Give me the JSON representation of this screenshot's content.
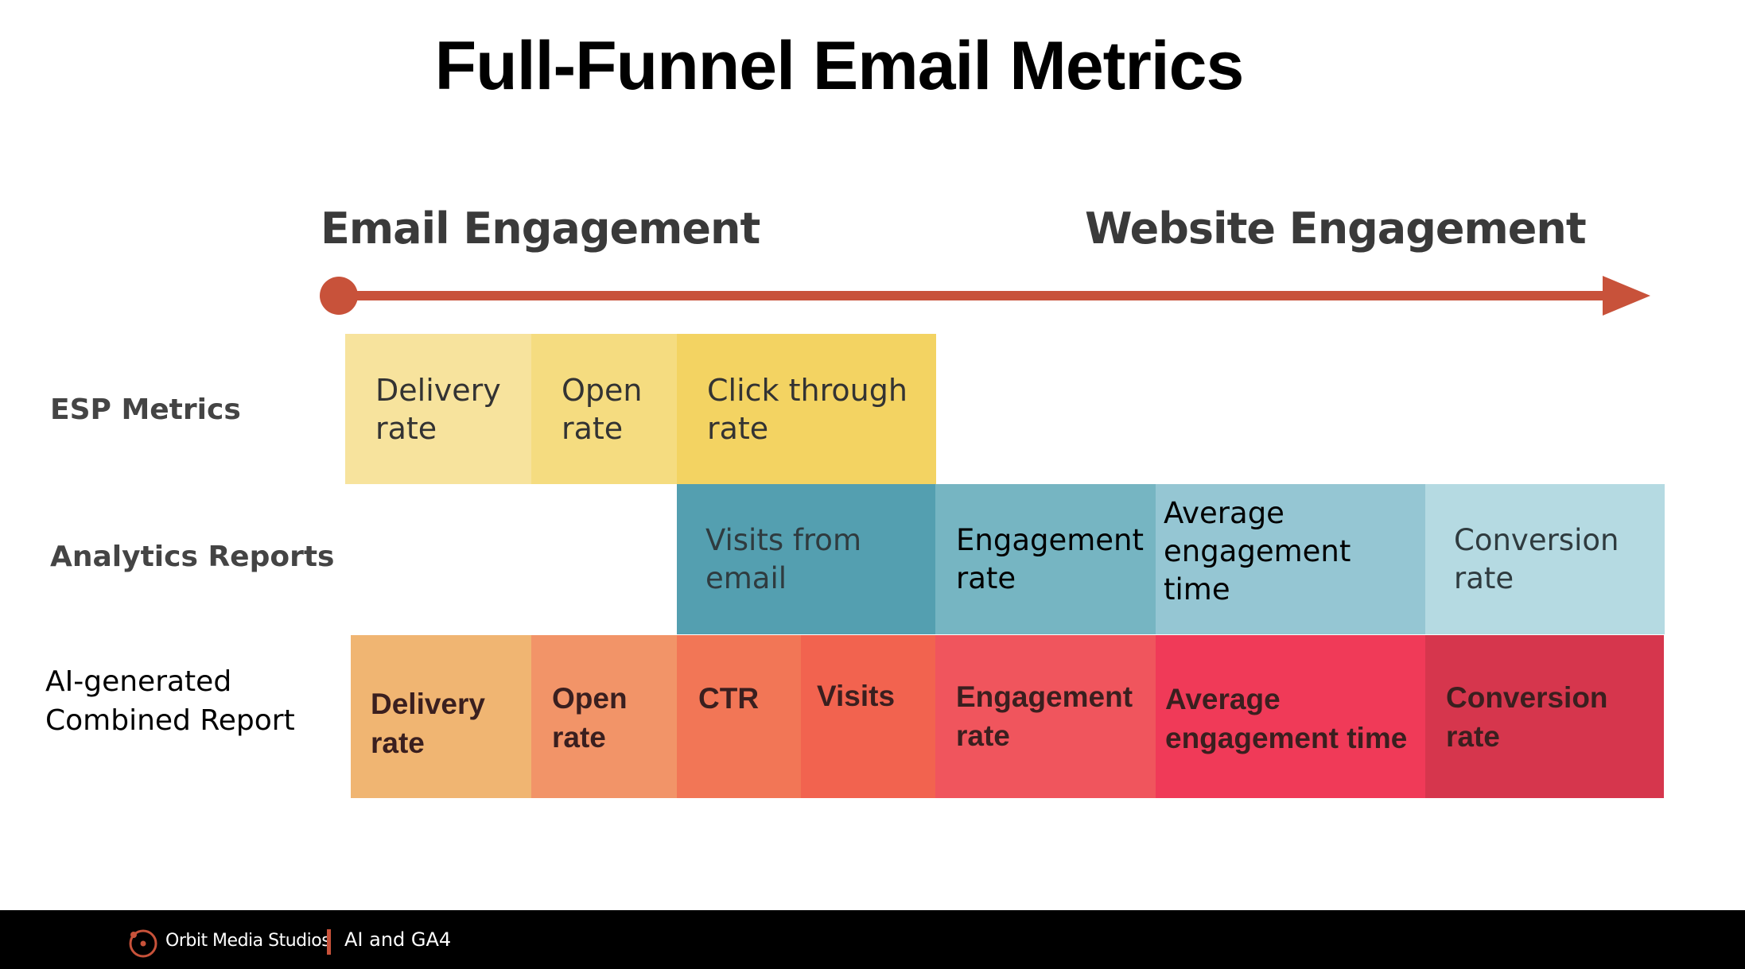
{
  "title": "Full-Funnel Email Metrics",
  "phases": {
    "start": "Email Engagement",
    "end": "Website Engagement"
  },
  "colors": {
    "arrow": "#c8523a"
  },
  "rows": [
    {
      "label": "ESP Metrics",
      "cells": [
        {
          "text": "Delivery\nrate",
          "color": "#f7e39d"
        },
        {
          "text": "Open\nrate",
          "color": "#f5dc80"
        },
        {
          "text": "Click through\nrate",
          "color": "#f3d362"
        }
      ]
    },
    {
      "label": "Analytics Reports",
      "cells": [
        {
          "text": "Visits from\nemail",
          "color": "#549fb0"
        },
        {
          "text": "Engagement\nrate",
          "color": "#76b5c2"
        },
        {
          "text": "Average\nengagement time",
          "color": "#95c6d3"
        },
        {
          "text": "Conversion\nrate",
          "color": "#b5dae2"
        }
      ]
    },
    {
      "label": "AI-generated\nCombined Report",
      "cells": [
        {
          "text": "Delivery\nrate",
          "color": "#f0b572"
        },
        {
          "text": "Open\nrate",
          "color": "#f29468"
        },
        {
          "text": "CTR",
          "color": "#f27656"
        },
        {
          "text": "Visits",
          "color": "#f2634f"
        },
        {
          "text": "Engagement\nrate",
          "color": "#f0555d"
        },
        {
          "text": "Average\nengagement time",
          "color": "#f03a58"
        },
        {
          "text": "Conversion\nrate",
          "color": "#d6364d"
        }
      ]
    }
  ],
  "footer": {
    "brand": "Orbit Media Studios",
    "deck_title": "AI and GA4"
  }
}
